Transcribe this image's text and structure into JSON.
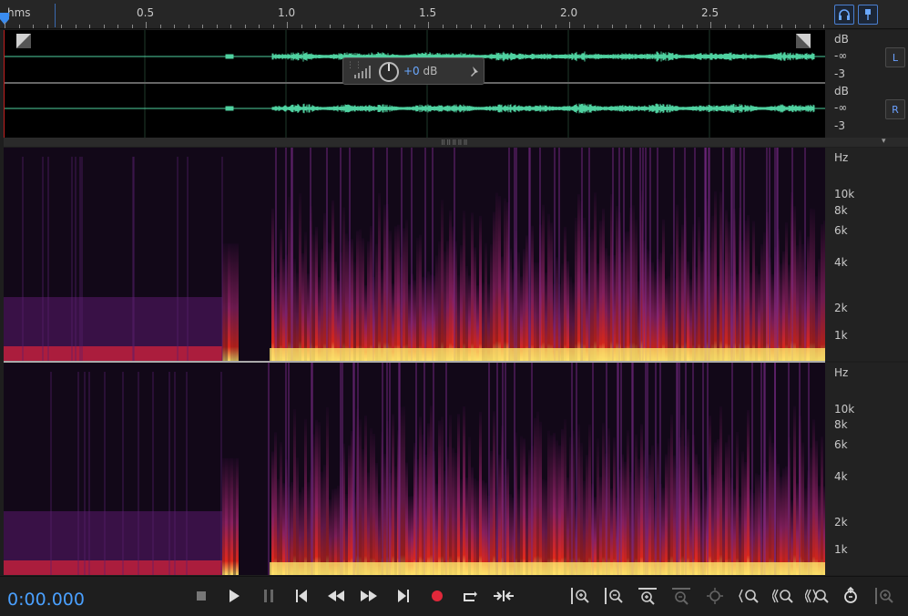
{
  "ruler": {
    "unit_label": "hms",
    "ticks": [
      "0.5",
      "1.0",
      "1.5",
      "2.0",
      "2.5"
    ]
  },
  "waveform": {
    "channels": [
      {
        "db_title": "dB",
        "db_top": "-∞",
        "db_bottom": "-3",
        "channel_button": "L"
      },
      {
        "db_title": "dB",
        "db_top": "-∞",
        "db_bottom": "-3",
        "channel_button": "R"
      }
    ],
    "wave_color": "#4fd1a0"
  },
  "hud": {
    "gain_value": "+0",
    "gain_unit": "dB"
  },
  "spectral": {
    "hz_title": "Hz",
    "hz_labels": [
      "10k",
      "8k",
      "6k",
      "4k",
      "2k",
      "1k"
    ]
  },
  "transport": {
    "time": "0:00.000",
    "buttons": [
      "stop-icon",
      "play-icon",
      "pause-icon",
      "move-to-previous-icon",
      "rewind-icon",
      "fast-forward-icon",
      "move-to-next-icon",
      "record-icon",
      "loop-playback-icon",
      "skip-selection-icon"
    ]
  },
  "zoom": {
    "buttons": [
      "zoom-in-amplitude-icon",
      "zoom-out-amplitude-icon",
      "zoom-in-time-icon",
      "zoom-out-full-icon",
      "zoom-to-selection-icon",
      "zoom-in-left-icon",
      "zoom-in-right-icon",
      "zoom-out-time-icon",
      "zoom-reset-icon",
      "zoom-frequency-icon"
    ]
  },
  "colors": {
    "accent": "#4aa0ff",
    "record": "#e0283a",
    "spectral_hot": "#ffe36a",
    "spectral_mid": "#e0281c",
    "spectral_low": "#5a1a6e"
  }
}
